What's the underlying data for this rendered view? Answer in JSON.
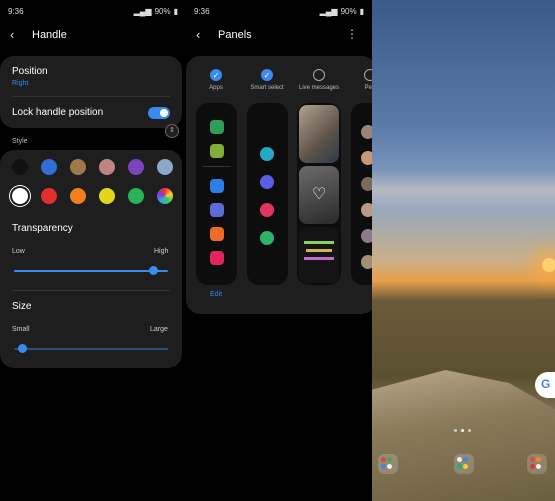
{
  "status": {
    "time": "9:36",
    "battery": "90%"
  },
  "handle": {
    "title": "Handle",
    "position_label": "Position",
    "position_value": "Right",
    "lock_label": "Lock handle position",
    "lock_on": true,
    "style_label": "Style",
    "swatches": [
      "#111111",
      "#2f6fd6",
      "#a0794a",
      "#c08483",
      "#7b45c0",
      "#8aa8c8",
      "#ffffff",
      "#e0322a",
      "#f07f1c",
      "#e3d61a",
      "#28b455",
      "multicolor"
    ],
    "selected_swatch": 6,
    "transparency_label": "Transparency",
    "transparency_low": "Low",
    "transparency_high": "High",
    "transparency_level": 0.9,
    "size_label": "Size",
    "size_small": "Small",
    "size_large": "Large",
    "size_level": 0.05
  },
  "panels": {
    "title": "Panels",
    "items": [
      {
        "label": "Apps",
        "checked": true
      },
      {
        "label": "Smart select",
        "checked": true
      },
      {
        "label": "Live messages",
        "checked": false
      },
      {
        "label": "Peo",
        "checked": false
      }
    ],
    "edit_label": "Edit"
  },
  "colors": {
    "accent": "#3a8af0"
  }
}
